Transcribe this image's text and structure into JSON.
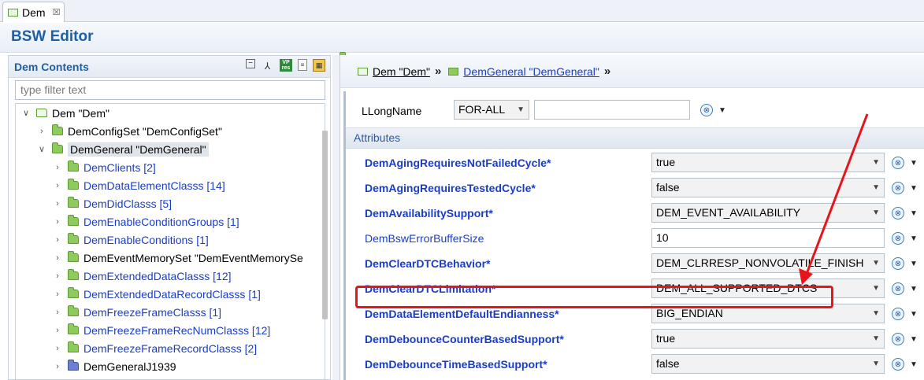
{
  "tab": {
    "label": "Dem",
    "close": "☒"
  },
  "editor": {
    "title": "BSW Editor"
  },
  "left_panel": {
    "title": "Dem Contents",
    "filter_placeholder": "type filter text",
    "tree": [
      {
        "label": "Dem \"Dem\"",
        "level": 0,
        "expanded": true,
        "icon": "outline",
        "color": "black"
      },
      {
        "label": "DemConfigSet \"DemConfigSet\"",
        "level": 1,
        "expanded": false,
        "icon": "green",
        "color": "black"
      },
      {
        "label": "DemGeneral \"DemGeneral\"",
        "level": 1,
        "expanded": true,
        "icon": "green",
        "color": "black",
        "selected": true
      },
      {
        "label": "DemClients [2]",
        "level": 2,
        "icon": "green",
        "color": "blue"
      },
      {
        "label": "DemDataElementClasss [14]",
        "level": 2,
        "icon": "green",
        "color": "blue"
      },
      {
        "label": "DemDidClasss [5]",
        "level": 2,
        "icon": "green",
        "color": "blue"
      },
      {
        "label": "DemEnableConditionGroups [1]",
        "level": 2,
        "icon": "green",
        "color": "blue"
      },
      {
        "label": "DemEnableConditions [1]",
        "level": 2,
        "icon": "green",
        "color": "blue"
      },
      {
        "label": "DemEventMemorySet \"DemEventMemorySe",
        "level": 2,
        "icon": "green",
        "color": "black"
      },
      {
        "label": "DemExtendedDataClasss [12]",
        "level": 2,
        "icon": "green",
        "color": "blue"
      },
      {
        "label": "DemExtendedDataRecordClasss [1]",
        "level": 2,
        "icon": "green",
        "color": "blue"
      },
      {
        "label": "DemFreezeFrameClasss [1]",
        "level": 2,
        "icon": "green",
        "color": "blue"
      },
      {
        "label": "DemFreezeFrameRecNumClasss [12]",
        "level": 2,
        "icon": "green",
        "color": "blue"
      },
      {
        "label": "DemFreezeFrameRecordClasss [2]",
        "level": 2,
        "icon": "green",
        "color": "blue"
      },
      {
        "label": "DemGeneralJ1939",
        "level": 2,
        "icon": "blue",
        "color": "black"
      }
    ]
  },
  "breadcrumb": {
    "items": [
      "Dem \"Dem\"",
      "DemGeneral \"DemGeneral\""
    ],
    "separator": "»"
  },
  "longname": {
    "label": "LLongName",
    "language": "FOR-ALL",
    "value": ""
  },
  "attributes": {
    "header": "Attributes",
    "rows": [
      {
        "name": "DemAgingRequiresNotFailedCycle*",
        "value": "true",
        "bold": true,
        "kind": "combo"
      },
      {
        "name": "DemAgingRequiresTestedCycle*",
        "value": "false",
        "bold": true,
        "kind": "combo"
      },
      {
        "name": "DemAvailabilitySupport*",
        "value": "DEM_EVENT_AVAILABILITY",
        "bold": true,
        "kind": "combo"
      },
      {
        "name": "DemBswErrorBufferSize",
        "value": "10",
        "bold": false,
        "kind": "text"
      },
      {
        "name": "DemClearDTCBehavior*",
        "value": "DEM_CLRRESP_NONVOLATILE_FINISH",
        "bold": true,
        "kind": "combo"
      },
      {
        "name": "DemClearDTCLimitation*",
        "value": "DEM_ALL_SUPPORTED_DTCS",
        "bold": true,
        "kind": "combo",
        "highlighted": true
      },
      {
        "name": "DemDataElementDefaultEndianness*",
        "value": "BIG_ENDIAN",
        "bold": true,
        "kind": "combo"
      },
      {
        "name": "DemDebounceCounterBasedSupport*",
        "value": "true",
        "bold": true,
        "kind": "combo"
      },
      {
        "name": "DemDebounceTimeBasedSupport*",
        "value": "false",
        "bold": true,
        "kind": "combo"
      }
    ]
  },
  "colors": {
    "accent": "#1e5fa6",
    "link": "#1a3dc8",
    "highlight": "#e8141b"
  },
  "icons": [
    "folder-icon",
    "collapse-all-icon",
    "hierarchy-icon",
    "vp-res-icon",
    "document-icon",
    "grid-icon",
    "action-icon",
    "chevron-down-icon"
  ]
}
